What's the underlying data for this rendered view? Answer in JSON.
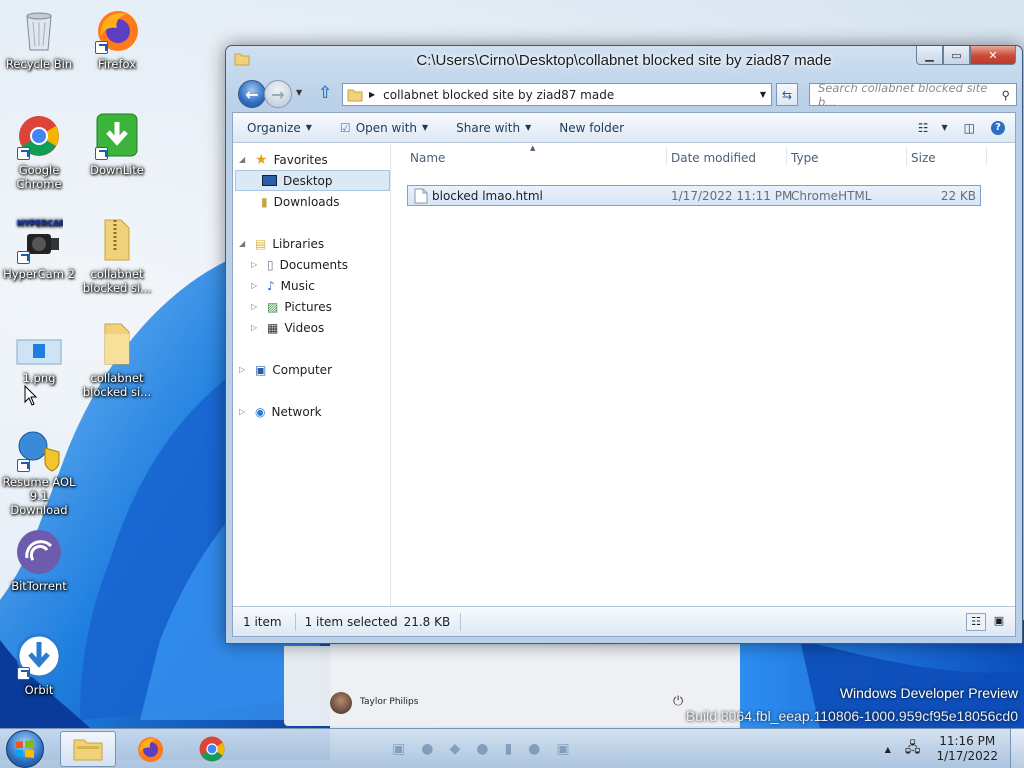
{
  "desktop": {
    "icons": [
      {
        "label": "Recycle Bin"
      },
      {
        "label": "Firefox"
      },
      {
        "label": "Google Chrome"
      },
      {
        "label": "DownLite"
      },
      {
        "label": "HyperCam 2"
      },
      {
        "label": "collabnet blocked si..."
      },
      {
        "label": "1.png"
      },
      {
        "label": "collabnet blocked si..."
      },
      {
        "label": "Resume AOL 9.1 Download"
      },
      {
        "label": "BitTorrent"
      },
      {
        "label": "Orbit"
      }
    ],
    "watermark": {
      "line1": "Windows Developer Preview",
      "line2": "Build 8064.fbl_eeap.110806-1000.959cf95e18056cd0"
    },
    "start_panel_user": "Taylor Philips"
  },
  "window": {
    "title": "C:\\Users\\Cirno\\Desktop\\collabnet blocked site by ziad87 made",
    "address": "collabnet blocked site by ziad87 made",
    "search_placeholder": "Search collabnet blocked site b...",
    "toolbar": {
      "organize": "Organize",
      "open_with": "Open with",
      "share_with": "Share with",
      "new_folder": "New folder"
    },
    "nav": {
      "favorites": "Favorites",
      "desktop": "Desktop",
      "downloads": "Downloads",
      "libraries": "Libraries",
      "documents": "Documents",
      "music": "Music",
      "pictures": "Pictures",
      "videos": "Videos",
      "computer": "Computer",
      "network": "Network"
    },
    "columns": {
      "name": "Name",
      "date": "Date modified",
      "type": "Type",
      "size": "Size"
    },
    "files": [
      {
        "name": "blocked lmao.html",
        "date": "1/17/2022 11:11 PM",
        "type": "ChromeHTML",
        "size": "22 KB"
      }
    ],
    "status": {
      "count": "1 item",
      "selected": "1 item selected",
      "size": "21.8 KB"
    }
  },
  "taskbar": {
    "time": "11:16 PM",
    "date": "1/17/2022"
  }
}
